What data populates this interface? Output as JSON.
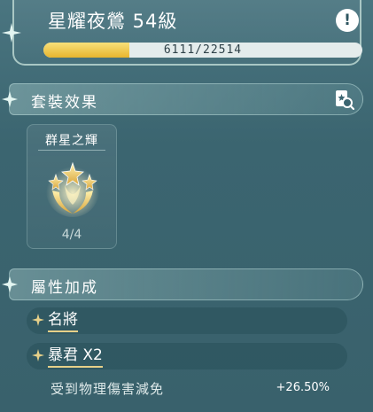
{
  "header": {
    "title": "星耀夜鶯 54級",
    "xp_text": "6111/22514",
    "xp_progress": 0.27,
    "alert_icon": "exclamation-icon"
  },
  "set_section": {
    "title": "套裝效果",
    "search_icon": "card-search-icon",
    "set": {
      "name": "群星之輝",
      "count": "4/4",
      "emblem_icon": "star-cluster-emblem-icon"
    }
  },
  "attr_section": {
    "title": "屬性加成",
    "items": [
      {
        "label": "名將"
      },
      {
        "label": "暴君 X2"
      }
    ],
    "stats": [
      {
        "label": "受到物理傷害減免",
        "value": "+26.50%"
      }
    ]
  },
  "colors": {
    "accent_gold": "#e8b52e",
    "underline_gold": "#e6d089",
    "background": "#3d6670"
  }
}
